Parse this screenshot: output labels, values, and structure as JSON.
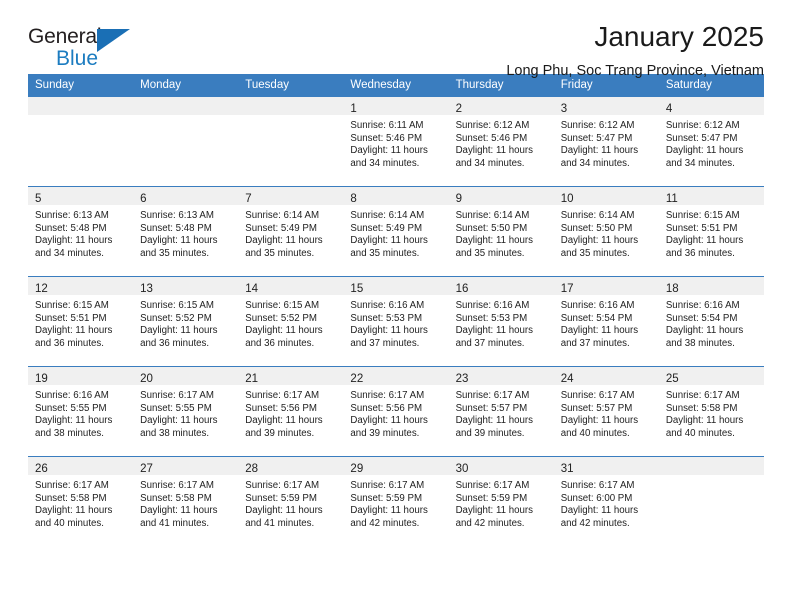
{
  "brand": {
    "name_top": "General",
    "name_bottom": "Blue",
    "accent_color": "#1a6fb5"
  },
  "header": {
    "title": "January 2025",
    "subtitle": "Long Phu, Soc Trang Province, Vietnam"
  },
  "theme": {
    "header_row_bg": "#3a7dbf",
    "daynum_band_bg": "#f0f0f0",
    "text_color": "#222222"
  },
  "weekday_headers": [
    "Sunday",
    "Monday",
    "Tuesday",
    "Wednesday",
    "Thursday",
    "Friday",
    "Saturday"
  ],
  "weeks": [
    [
      {
        "day": "",
        "lines": []
      },
      {
        "day": "",
        "lines": []
      },
      {
        "day": "",
        "lines": []
      },
      {
        "day": "1",
        "lines": [
          "Sunrise: 6:11 AM",
          "Sunset: 5:46 PM",
          "Daylight: 11 hours",
          "and 34 minutes."
        ]
      },
      {
        "day": "2",
        "lines": [
          "Sunrise: 6:12 AM",
          "Sunset: 5:46 PM",
          "Daylight: 11 hours",
          "and 34 minutes."
        ]
      },
      {
        "day": "3",
        "lines": [
          "Sunrise: 6:12 AM",
          "Sunset: 5:47 PM",
          "Daylight: 11 hours",
          "and 34 minutes."
        ]
      },
      {
        "day": "4",
        "lines": [
          "Sunrise: 6:12 AM",
          "Sunset: 5:47 PM",
          "Daylight: 11 hours",
          "and 34 minutes."
        ]
      }
    ],
    [
      {
        "day": "5",
        "lines": [
          "Sunrise: 6:13 AM",
          "Sunset: 5:48 PM",
          "Daylight: 11 hours",
          "and 34 minutes."
        ]
      },
      {
        "day": "6",
        "lines": [
          "Sunrise: 6:13 AM",
          "Sunset: 5:48 PM",
          "Daylight: 11 hours",
          "and 35 minutes."
        ]
      },
      {
        "day": "7",
        "lines": [
          "Sunrise: 6:14 AM",
          "Sunset: 5:49 PM",
          "Daylight: 11 hours",
          "and 35 minutes."
        ]
      },
      {
        "day": "8",
        "lines": [
          "Sunrise: 6:14 AM",
          "Sunset: 5:49 PM",
          "Daylight: 11 hours",
          "and 35 minutes."
        ]
      },
      {
        "day": "9",
        "lines": [
          "Sunrise: 6:14 AM",
          "Sunset: 5:50 PM",
          "Daylight: 11 hours",
          "and 35 minutes."
        ]
      },
      {
        "day": "10",
        "lines": [
          "Sunrise: 6:14 AM",
          "Sunset: 5:50 PM",
          "Daylight: 11 hours",
          "and 35 minutes."
        ]
      },
      {
        "day": "11",
        "lines": [
          "Sunrise: 6:15 AM",
          "Sunset: 5:51 PM",
          "Daylight: 11 hours",
          "and 36 minutes."
        ]
      }
    ],
    [
      {
        "day": "12",
        "lines": [
          "Sunrise: 6:15 AM",
          "Sunset: 5:51 PM",
          "Daylight: 11 hours",
          "and 36 minutes."
        ]
      },
      {
        "day": "13",
        "lines": [
          "Sunrise: 6:15 AM",
          "Sunset: 5:52 PM",
          "Daylight: 11 hours",
          "and 36 minutes."
        ]
      },
      {
        "day": "14",
        "lines": [
          "Sunrise: 6:15 AM",
          "Sunset: 5:52 PM",
          "Daylight: 11 hours",
          "and 36 minutes."
        ]
      },
      {
        "day": "15",
        "lines": [
          "Sunrise: 6:16 AM",
          "Sunset: 5:53 PM",
          "Daylight: 11 hours",
          "and 37 minutes."
        ]
      },
      {
        "day": "16",
        "lines": [
          "Sunrise: 6:16 AM",
          "Sunset: 5:53 PM",
          "Daylight: 11 hours",
          "and 37 minutes."
        ]
      },
      {
        "day": "17",
        "lines": [
          "Sunrise: 6:16 AM",
          "Sunset: 5:54 PM",
          "Daylight: 11 hours",
          "and 37 minutes."
        ]
      },
      {
        "day": "18",
        "lines": [
          "Sunrise: 6:16 AM",
          "Sunset: 5:54 PM",
          "Daylight: 11 hours",
          "and 38 minutes."
        ]
      }
    ],
    [
      {
        "day": "19",
        "lines": [
          "Sunrise: 6:16 AM",
          "Sunset: 5:55 PM",
          "Daylight: 11 hours",
          "and 38 minutes."
        ]
      },
      {
        "day": "20",
        "lines": [
          "Sunrise: 6:17 AM",
          "Sunset: 5:55 PM",
          "Daylight: 11 hours",
          "and 38 minutes."
        ]
      },
      {
        "day": "21",
        "lines": [
          "Sunrise: 6:17 AM",
          "Sunset: 5:56 PM",
          "Daylight: 11 hours",
          "and 39 minutes."
        ]
      },
      {
        "day": "22",
        "lines": [
          "Sunrise: 6:17 AM",
          "Sunset: 5:56 PM",
          "Daylight: 11 hours",
          "and 39 minutes."
        ]
      },
      {
        "day": "23",
        "lines": [
          "Sunrise: 6:17 AM",
          "Sunset: 5:57 PM",
          "Daylight: 11 hours",
          "and 39 minutes."
        ]
      },
      {
        "day": "24",
        "lines": [
          "Sunrise: 6:17 AM",
          "Sunset: 5:57 PM",
          "Daylight: 11 hours",
          "and 40 minutes."
        ]
      },
      {
        "day": "25",
        "lines": [
          "Sunrise: 6:17 AM",
          "Sunset: 5:58 PM",
          "Daylight: 11 hours",
          "and 40 minutes."
        ]
      }
    ],
    [
      {
        "day": "26",
        "lines": [
          "Sunrise: 6:17 AM",
          "Sunset: 5:58 PM",
          "Daylight: 11 hours",
          "and 40 minutes."
        ]
      },
      {
        "day": "27",
        "lines": [
          "Sunrise: 6:17 AM",
          "Sunset: 5:58 PM",
          "Daylight: 11 hours",
          "and 41 minutes."
        ]
      },
      {
        "day": "28",
        "lines": [
          "Sunrise: 6:17 AM",
          "Sunset: 5:59 PM",
          "Daylight: 11 hours",
          "and 41 minutes."
        ]
      },
      {
        "day": "29",
        "lines": [
          "Sunrise: 6:17 AM",
          "Sunset: 5:59 PM",
          "Daylight: 11 hours",
          "and 42 minutes."
        ]
      },
      {
        "day": "30",
        "lines": [
          "Sunrise: 6:17 AM",
          "Sunset: 5:59 PM",
          "Daylight: 11 hours",
          "and 42 minutes."
        ]
      },
      {
        "day": "31",
        "lines": [
          "Sunrise: 6:17 AM",
          "Sunset: 6:00 PM",
          "Daylight: 11 hours",
          "and 42 minutes."
        ]
      },
      {
        "day": "",
        "lines": []
      }
    ]
  ]
}
